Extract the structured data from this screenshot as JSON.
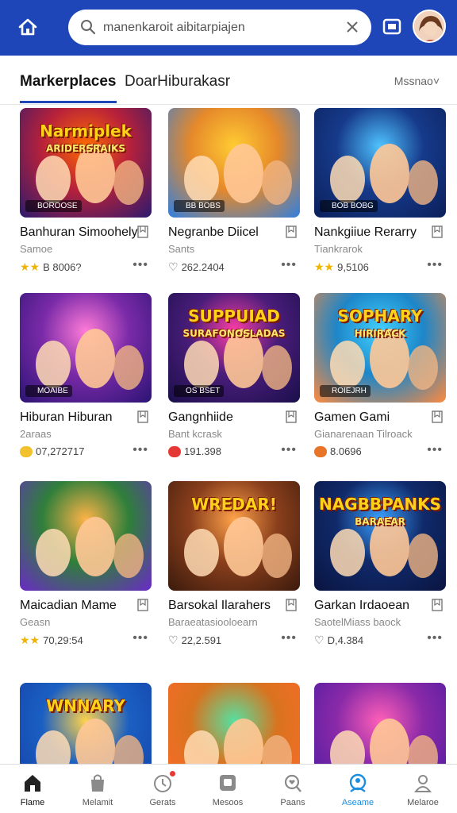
{
  "header": {
    "search_value": "manenkaroit aibitarpiajen",
    "colors": {
      "bar": "#1e46b8"
    }
  },
  "tabs": {
    "active": "Markerplaces",
    "inactive": "DoarHiburakasr",
    "sort": "Mssnao˅"
  },
  "cards": [
    {
      "thumb_title": "Narmiplek",
      "thumb_sub": "ARIDERSRAIKS",
      "badge": " BOROOSE",
      "title": "Banhuran Simoohely",
      "sub": "Samoe",
      "rating_icon": "stars",
      "rating": "B 8006?",
      "bg": "#b8213a"
    },
    {
      "thumb_title": "",
      "thumb_sub": "",
      "badge": " BB BOBS",
      "title": "Negranbe Diicel",
      "sub": "Sants",
      "rating_icon": "heart",
      "rating": "262.2404",
      "bg": "#e6892a"
    },
    {
      "thumb_title": "",
      "thumb_sub": "",
      "badge": " BOB BOBG",
      "title": "Nankgiiue Rerarry",
      "sub": "Tiankrarok",
      "rating_icon": "stars",
      "rating": "9,5106",
      "bg": "#163a8a"
    },
    {
      "thumb_title": "",
      "thumb_sub": "",
      "badge": " MOAIBE",
      "title": "Hiburan Hiburan",
      "sub": "2araas",
      "rating_icon": "coin-yellow",
      "rating": "07,272717",
      "bg": "#7a2aa8"
    },
    {
      "thumb_title": "SUPPUIAD",
      "thumb_sub": "SURAFONOSLADAS",
      "badge": " OS BSET",
      "title": "Gangnhiide",
      "sub": "Bant kcrask",
      "rating_icon": "coin-red",
      "rating": "191.398",
      "bg": "#4a1d7a"
    },
    {
      "thumb_title": "SOPHARY",
      "thumb_sub": "HIRIRACK",
      "badge": " ROIEJRH",
      "title": "Gamen Gami",
      "sub": "Gianarenaan Tilroack",
      "rating_icon": "coin-orange",
      "rating": "8.0696",
      "bg": "#1d86c9"
    },
    {
      "thumb_title": "",
      "thumb_sub": "",
      "badge": "",
      "title": "Maicadian Mame",
      "sub": "Geasn",
      "rating_icon": "stars",
      "rating": "70,29:54",
      "bg": "#2f7f3a"
    },
    {
      "thumb_title": "WREDAR!",
      "thumb_sub": "",
      "badge": "",
      "title": "Barsokal Ilarahers",
      "sub": "Baraeatasiooloearn",
      "rating_icon": "heart",
      "rating": "22,2.591",
      "bg": "#8a3f1c"
    },
    {
      "thumb_title": "NAGBBPANKS",
      "thumb_sub": "BARAEAR",
      "badge": "",
      "title": "Garkan Irdaoean",
      "sub": "SaotelMiass baock",
      "rating_icon": "heart",
      "rating": "D,4.384",
      "bg": "#102a6a"
    },
    {
      "thumb_title": "WNNARY",
      "thumb_sub": "",
      "badge": "",
      "title": "",
      "sub": "",
      "rating_icon": "",
      "rating": "",
      "bg": "#1a5fc2"
    },
    {
      "thumb_title": "",
      "thumb_sub": "",
      "badge": "",
      "title": "",
      "sub": "",
      "rating_icon": "",
      "rating": "",
      "bg": "#d9731f"
    },
    {
      "thumb_title": "",
      "thumb_sub": "",
      "badge": "",
      "title": "",
      "sub": "",
      "rating_icon": "",
      "rating": "",
      "bg": "#8a2aa8"
    }
  ],
  "more_label": "•••",
  "nav": [
    {
      "label": "Flame",
      "icon": "home-icon"
    },
    {
      "label": "Melamit",
      "icon": "bag-icon"
    },
    {
      "label": "Gerats",
      "icon": "clock-icon"
    },
    {
      "label": "Mesoos",
      "icon": "message-icon"
    },
    {
      "label": "Paans",
      "icon": "search-heart-icon"
    },
    {
      "label": "Aseame",
      "icon": "community-icon"
    },
    {
      "label": "Melaroe",
      "icon": "profile-icon"
    }
  ]
}
